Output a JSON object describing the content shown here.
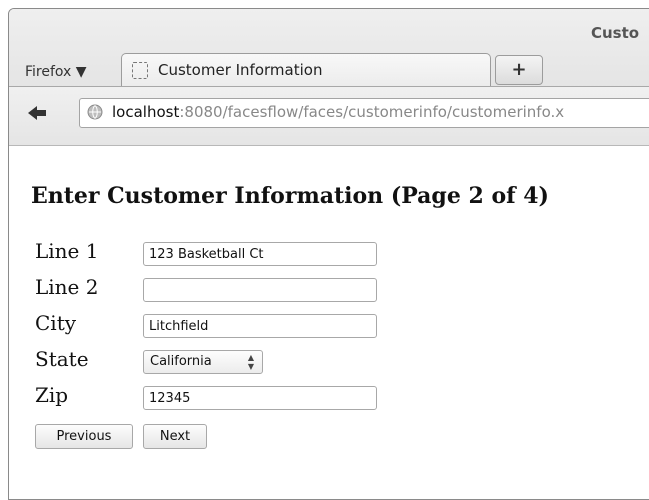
{
  "window": {
    "title": "Custo"
  },
  "browser": {
    "menu_label": "Firefox ▼",
    "tab_title": "Customer Information",
    "new_tab_label": "+",
    "url_host": "localhost",
    "url_rest": ":8080/facesflow/faces/customerinfo/customerinfo.x"
  },
  "page": {
    "heading": "Enter Customer Information (Page 2 of 4)",
    "fields": {
      "line1": {
        "label": "Line 1",
        "value": "123 Basketball Ct"
      },
      "line2": {
        "label": "Line 2",
        "value": ""
      },
      "city": {
        "label": "City",
        "value": "Litchfield"
      },
      "state": {
        "label": "State",
        "value": "California"
      },
      "zip": {
        "label": "Zip",
        "value": "12345"
      }
    },
    "buttons": {
      "previous": "Previous",
      "next": "Next"
    }
  },
  "icons": {
    "back": "back-arrow-icon",
    "site_identity": "globe-icon",
    "favicon": "page-icon",
    "select_spinner": "up-down-arrows-icon"
  }
}
